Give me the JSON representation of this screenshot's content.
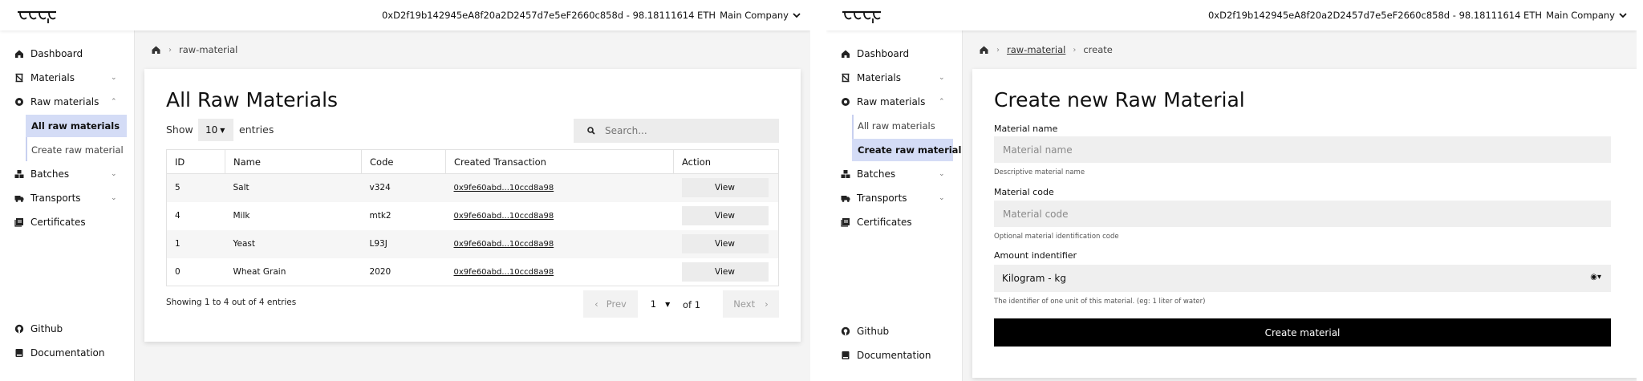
{
  "left": {
    "wallet": "0xD2f19b142945eA8f20a2D2457d7e5eF2660c858d - 98.18111614 ETH",
    "company": "Main Company",
    "nav": {
      "dashboard": "Dashboard",
      "materials": "Materials",
      "raw_materials": "Raw materials",
      "sub_all": "All raw materials",
      "sub_create": "Create raw material",
      "batches": "Batches",
      "transports": "Transports",
      "certificates": "Certificates",
      "github": "Github",
      "documentation": "Documentation"
    },
    "breadcrumb": [
      "raw-material"
    ],
    "title": "All Raw Materials",
    "show_label": "Show",
    "entries_value": "10",
    "entries_label": "entries",
    "search_placeholder": "Search...",
    "table": {
      "columns": [
        "ID",
        "Name",
        "Code",
        "Created Transaction",
        "Action"
      ],
      "rows": [
        {
          "id": "5",
          "name": "Salt",
          "code": "v324",
          "tx": "0x9fe60abd...10ccd8a98",
          "action": "View"
        },
        {
          "id": "4",
          "name": "Milk",
          "code": "mtk2",
          "tx": "0x9fe60abd...10ccd8a98",
          "action": "View"
        },
        {
          "id": "1",
          "name": "Yeast",
          "code": "L93J",
          "tx": "0x9fe60abd...10ccd8a98",
          "action": "View"
        },
        {
          "id": "0",
          "name": "Wheat Grain",
          "code": "2020",
          "tx": "0x9fe60abd...10ccd8a98",
          "action": "View"
        }
      ]
    },
    "footer": "Showing 1 to 4 out of 4 entries",
    "pagination": {
      "prev": "Prev",
      "page": "1",
      "of": "of 1",
      "next": "Next"
    }
  },
  "right": {
    "wallet": "0xD2f19b142945eA8f20a2D2457d7e5eF2660c858d - 98.18111614 ETH",
    "company": "Main Company",
    "nav": {
      "dashboard": "Dashboard",
      "materials": "Materials",
      "raw_materials": "Raw materials",
      "sub_all": "All raw materials",
      "sub_create": "Create raw material",
      "batches": "Batches",
      "transports": "Transports",
      "certificates": "Certificates",
      "github": "Github",
      "documentation": "Documentation"
    },
    "breadcrumb": [
      "raw-material",
      "create"
    ],
    "title": "Create new Raw Material",
    "form": {
      "name_label": "Material name",
      "name_placeholder": "Material name",
      "name_hint": "Descriptive material name",
      "code_label": "Material code",
      "code_placeholder": "Material code",
      "code_hint": "Optional material identification code",
      "amount_label": "Amount indentifier",
      "amount_value": "Kilogram - kg",
      "amount_hint": "The identifier of one unit of this material. (eg: 1 liter of water)",
      "submit": "Create material"
    }
  }
}
